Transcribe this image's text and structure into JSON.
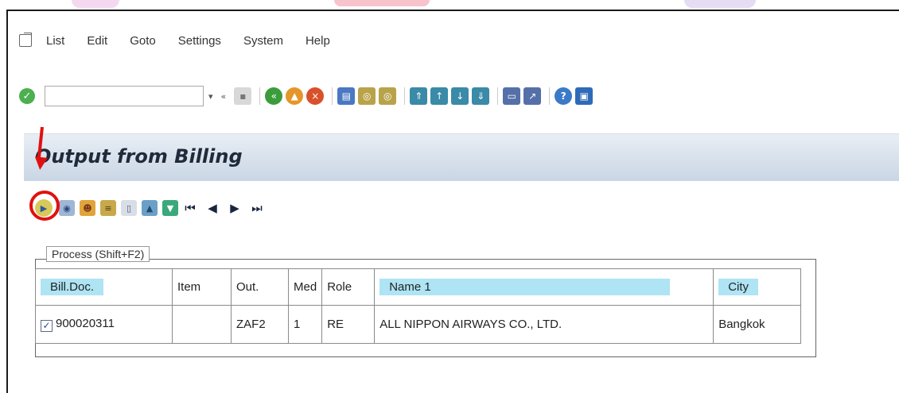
{
  "menu": {
    "items": [
      "List",
      "Edit",
      "Goto",
      "Settings",
      "System",
      "Help"
    ]
  },
  "toolbar": {
    "command_field_value": "",
    "dropdown_glyph": "▾",
    "back_glyph": "«"
  },
  "page": {
    "title": "Output from Billing"
  },
  "app_toolbar": {
    "tooltip": "Process  (Shift+F2)"
  },
  "table": {
    "headers": [
      "Bill.Doc.",
      "Item",
      "Out.",
      "Med",
      "Role",
      "Name 1",
      "City"
    ],
    "rows": [
      {
        "checked": true,
        "bill_doc": "900020311",
        "item": "",
        "out": "ZAF2",
        "med": "1",
        "role": "RE",
        "name1": "ALL NIPPON AIRWAYS CO., LTD.",
        "city": "Bangkok"
      }
    ]
  },
  "colors": {
    "annotation_red": "#e11010",
    "header_highlight": "#aee4f4",
    "title_band": "#c9d6e4"
  }
}
